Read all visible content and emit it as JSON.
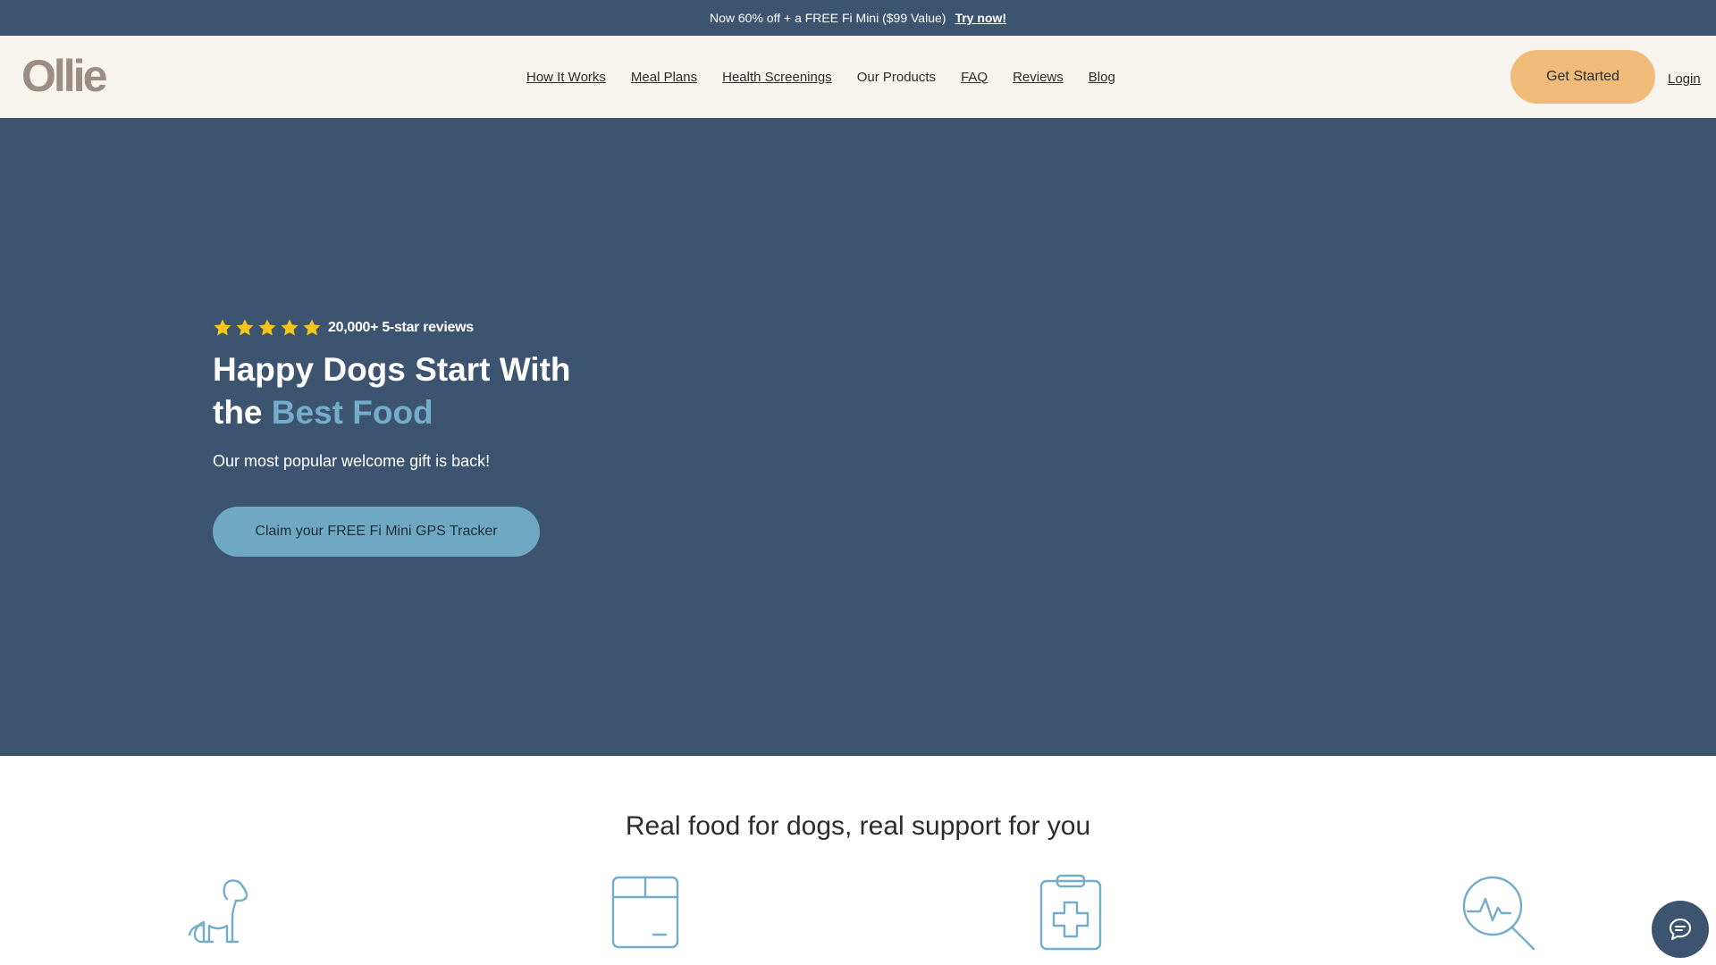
{
  "announcement": {
    "text": "Now 60% off + a FREE Fi Mini ($99 Value)",
    "link_label": "Try now!"
  },
  "header": {
    "logo_text": "Ollie",
    "nav": [
      {
        "label": "How It Works"
      },
      {
        "label": "Meal Plans"
      },
      {
        "label": "Health Screenings"
      },
      {
        "label": "Our Products"
      },
      {
        "label": "FAQ"
      },
      {
        "label": "Reviews"
      },
      {
        "label": "Blog"
      }
    ],
    "cta_label": "Get Started",
    "login_label": "Login"
  },
  "hero": {
    "rating_stars": 5,
    "rating_text": "20,000+ 5-star reviews",
    "title_line1": "Happy Dogs Start With",
    "title_the": "the",
    "title_accent": "Best Food",
    "subtitle": "Our most popular welcome gift is back!",
    "cta_label": "Claim your FREE Fi Mini GPS Tracker"
  },
  "features": {
    "heading": "Real food for dogs, real support for you",
    "icons": [
      "dog-icon",
      "box-icon",
      "clipboard-medical-icon",
      "health-search-icon"
    ]
  },
  "colors": {
    "navy": "#3c5470",
    "cream": "#f6f4ec",
    "orange": "#f0bb78",
    "accent_blue": "#74adc9",
    "star_yellow": "#f5c518"
  },
  "chat": {
    "icon": "chat-icon"
  }
}
